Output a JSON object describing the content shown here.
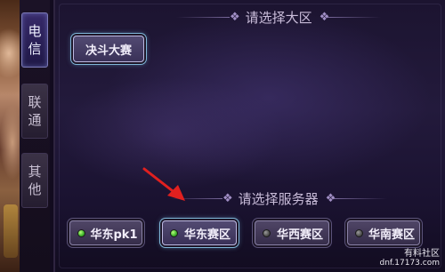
{
  "tabs": [
    {
      "label": "电信",
      "active": true
    },
    {
      "label": "联通",
      "active": false
    },
    {
      "label": "其他",
      "active": false
    }
  ],
  "region_section": {
    "header": "请选择大区",
    "regions": [
      {
        "label": "决斗大赛"
      }
    ]
  },
  "server_section": {
    "header": "请选择服务器",
    "servers": [
      {
        "label": "华东pk1",
        "status": "online"
      },
      {
        "label": "华东赛区",
        "status": "online",
        "highlighted": true
      },
      {
        "label": "华西赛区",
        "status": "offline"
      },
      {
        "label": "华南赛区",
        "status": "offline"
      }
    ]
  },
  "annotation": {
    "icon": "red-arrow-icon",
    "color": "#e0201f"
  },
  "watermark": {
    "line1": "有料社区",
    "line2": "dnf.17173.com"
  }
}
